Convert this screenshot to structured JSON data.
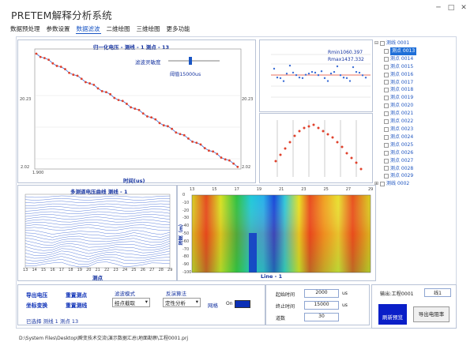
{
  "app": {
    "title": "PRETEM解释分析系统"
  },
  "window_buttons": [
    "─",
    "□",
    "✕"
  ],
  "menu": [
    {
      "label": "数据预处理",
      "active": false
    },
    {
      "label": "参数设置",
      "active": false
    },
    {
      "label": "数据滤波",
      "active": true
    },
    {
      "label": "二维绘图",
      "active": false
    },
    {
      "label": "三维绘图",
      "active": false
    },
    {
      "label": "更多功能",
      "active": false
    }
  ],
  "main_chart": {
    "title": "归一化电压 - 测线 - 1 测点 - 13",
    "filter_label": "滤波灵敏度",
    "threshold_label": "阈值15000us",
    "y_top": "20.23",
    "y_bottom": "2.02",
    "x_left": "1.900",
    "xlabel": "时间(us)"
  },
  "res_chart": {
    "rmin": "Rmin1060.397",
    "rmax": "Rmax1437.332"
  },
  "tree": {
    "root": "测线 0001",
    "items": [
      "测点 0013",
      "测点 0014",
      "测点 0015",
      "测点 0016",
      "测点 0017",
      "测点 0018",
      "测点 0019",
      "测点 0020",
      "测点 0021",
      "测点 0022",
      "测点 0023",
      "测点 0024",
      "测点 0025",
      "测点 0026",
      "测点 0027",
      "测点 0028",
      "测点 0029"
    ],
    "selected": "测点 0013",
    "root2": "测线 0002"
  },
  "multi_chart": {
    "title": "多测道电压曲线 测线 - 1",
    "xlabel": "测点",
    "xticks": [
      "13",
      "14",
      "15",
      "16",
      "17",
      "18",
      "19",
      "20",
      "21",
      "22",
      "23",
      "24",
      "25",
      "26",
      "27",
      "28",
      "29"
    ]
  },
  "heatmap": {
    "xticks": [
      "13",
      "15",
      "17",
      "19",
      "21",
      "23",
      "25",
      "27",
      "29"
    ],
    "yticks": [
      "0",
      "-10",
      "-20",
      "-30",
      "-40",
      "-50",
      "-60",
      "-70",
      "-80",
      "-90",
      "-100"
    ],
    "ylabel": "深度（m）",
    "xlabel": "Line - 1"
  },
  "controls": {
    "link_export_voltage": "导出电压",
    "link_coord_transform": "坐标变换",
    "link_rechoose_point": "重置测点",
    "link_rechoose_line": "重置测线",
    "filter_mode_label": "滤波模式",
    "filter_mode_value": "经点截取",
    "inversion_label": "反演算法",
    "inversion_value": "定性分析",
    "grid_label": "网格",
    "toggle_label": "On",
    "selected_info": "已选择 测线 1   测点 13",
    "start_time_label": "起始时间",
    "start_time_value": "2000",
    "end_time_label": "终止时间",
    "end_time_value": "15000",
    "channels_label": "道数",
    "channels_value": "30",
    "unit_us": "us",
    "export_label": "输出:工程0001",
    "line_value": "线1",
    "refresh_button": "刷新预览",
    "export_resistivity_button": "导出电阻率"
  },
  "status": {
    "path": "D:\\System Files\\Desktop\\瞬变技术交流\\演示数据汇总\\地面勘察\\工程0001.prj"
  },
  "colors": {
    "accent": "#1a56c4",
    "series_red": "#e0412c",
    "series_blue": "#3d6fd6"
  }
}
